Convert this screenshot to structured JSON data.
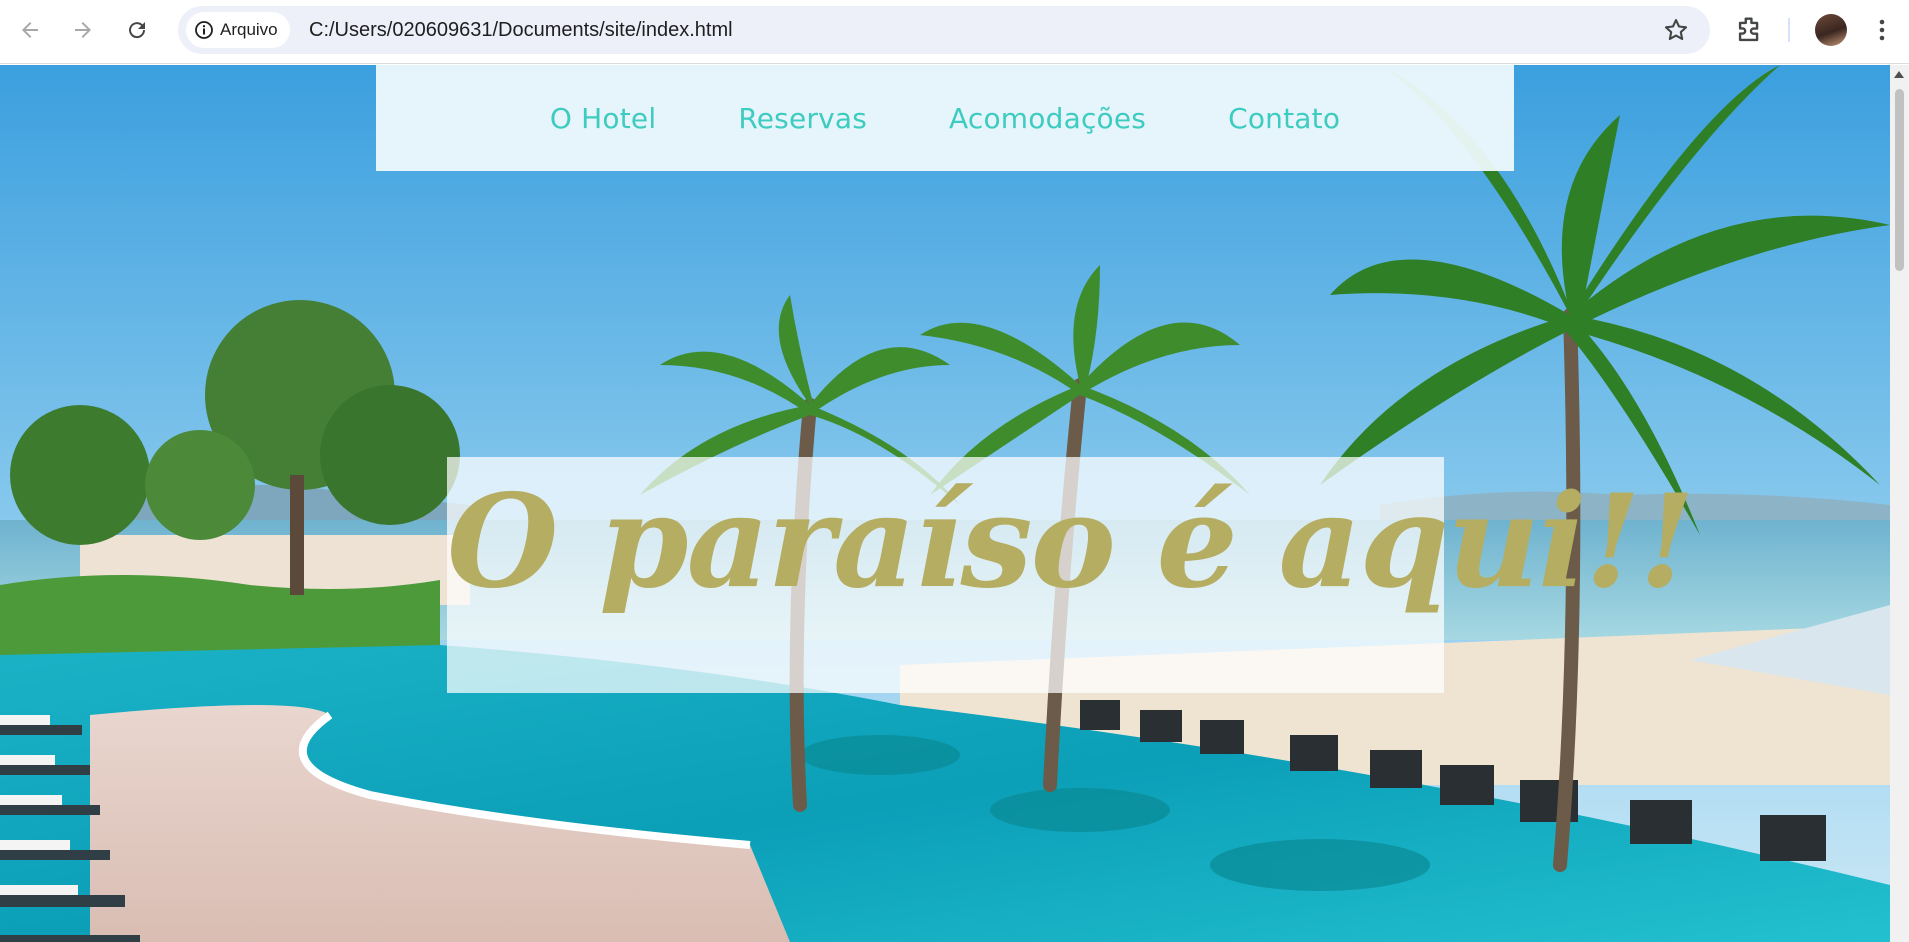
{
  "browser": {
    "site_info_label": "Arquivo",
    "url": "C:/Users/020609631/Documents/site/index.html",
    "icons": [
      "back-icon",
      "forward-icon",
      "reload-icon",
      "info-icon",
      "star-icon",
      "extensions-icon",
      "profile-avatar",
      "kebab-menu-icon"
    ]
  },
  "page": {
    "nav": {
      "items": [
        {
          "label": "O Hotel"
        },
        {
          "label": "Reservas"
        },
        {
          "label": "Acomodações"
        },
        {
          "label": "Contato"
        }
      ]
    },
    "hero": {
      "headline": "O paraíso é aqui!!"
    },
    "colors": {
      "nav_link": "#3ecbc0",
      "headline": "#b5ad62",
      "nav_background": "#f0fafd"
    }
  }
}
